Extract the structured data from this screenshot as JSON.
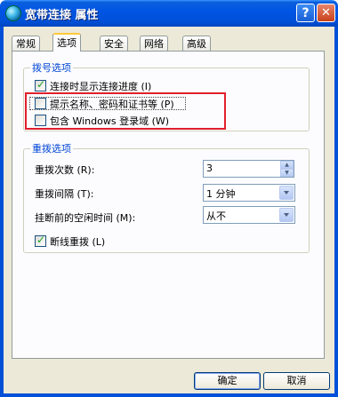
{
  "window": {
    "title": "宽带连接 属性",
    "help_glyph": "?",
    "close_glyph": "✕"
  },
  "tabs": [
    {
      "label": "常规"
    },
    {
      "label": "选项"
    },
    {
      "label": "安全"
    },
    {
      "label": "网络"
    },
    {
      "label": "高级"
    }
  ],
  "dial_options": {
    "group_label": "拨号选项",
    "items": [
      {
        "label": "连接时显示连接进度 (I)",
        "checked": true
      },
      {
        "label": "提示名称、密码和证书等 (P)",
        "checked": false
      },
      {
        "label": "包含 Windows 登录域 (W)",
        "checked": false
      }
    ]
  },
  "redial_options": {
    "group_label": "重拨选项",
    "redial_attempts_label": "重拨次数 (R):",
    "redial_attempts_value": "3",
    "redial_interval_label": "重拨间隔 (T):",
    "redial_interval_value": "1 分钟",
    "idle_hangup_label": "挂断前的空闲时间 (M):",
    "idle_hangup_value": "从不",
    "redial_if_dropped_label": "断线重拨 (L)",
    "redial_if_dropped_checked": true
  },
  "buttons": {
    "ok": "确定",
    "cancel": "取消"
  },
  "colors": {
    "title_bar": "#0055e5",
    "group_label": "#0046d5",
    "highlight_box": "#e0202a",
    "check": "#21a121"
  }
}
